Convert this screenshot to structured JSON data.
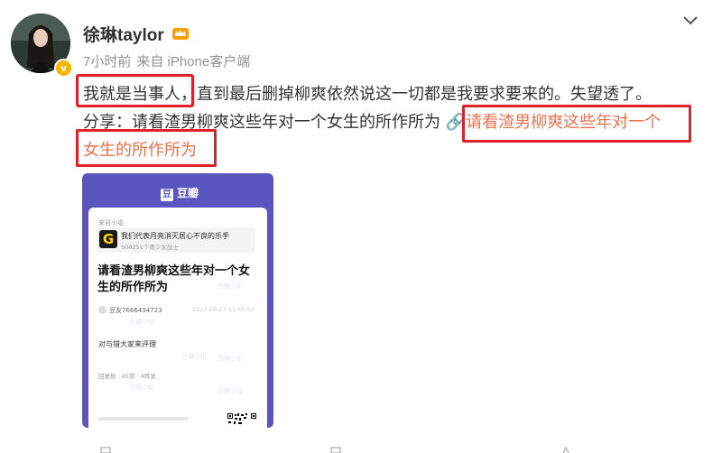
{
  "user": {
    "name": "徐琳taylor",
    "time": "7小时前",
    "source": "来自 iPhone客户端"
  },
  "post": {
    "highlight": "我就是当事人，",
    "line1_rest": "直到最后删掉柳爽依然说这一切都是我要求要来的。失望透了。",
    "share_prefix": "分享：请看渣男柳爽这些年对一个女生的所作所为",
    "link_part1": "请看渣男柳爽这些年对一个",
    "link_part2": "女生的所作所为"
  },
  "card": {
    "brand": "豆瓣",
    "brand_logo": "豆",
    "from_label": "来自小组",
    "group_name": "我们代表月亮消灭居心不良的乐手",
    "group_members": "500251个青少女战士",
    "title": "请看渣男柳爽这些年对一个女生的所作所为",
    "author": "豆友7666434723",
    "date": "2023-06-27 11:45:53",
    "body": "对与错大家来评理",
    "stats": "回复数 · 45赞 · 4转发",
    "watermark": "豆瓣小组"
  },
  "colors": {
    "link": "#eb7350",
    "highlight_border": "#e0212a",
    "card_bg": "#5b55c0",
    "verified": "#f7b500"
  }
}
